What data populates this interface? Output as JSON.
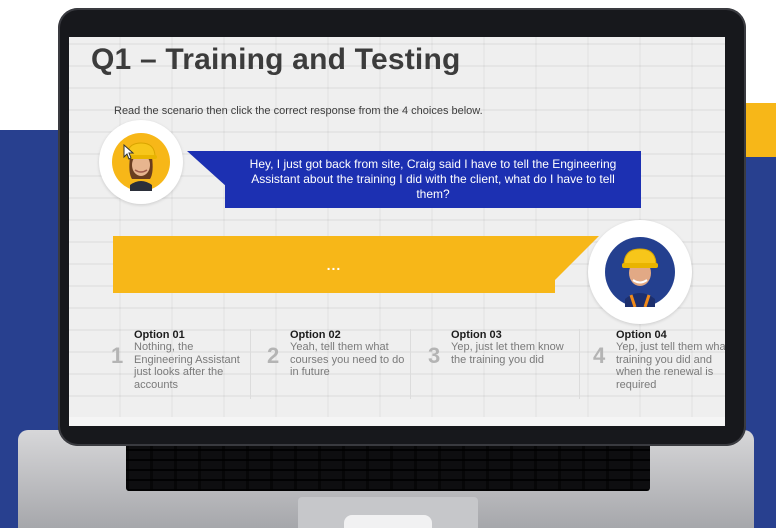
{
  "lesson": {
    "title": "Q1 – Training and Testing",
    "instruction": "Read the scenario then click the correct response from the 4 choices below."
  },
  "dialogue": {
    "speaker_message": "Hey, I just got back from site, Craig said I have to tell the Engineering Assistant about the training I did with the client, what do I have to tell them?",
    "response_placeholder": "..."
  },
  "options": [
    {
      "number": "1",
      "heading": "Option 01",
      "text": "Nothing, the Engineering Assistant just looks after the accounts"
    },
    {
      "number": "2",
      "heading": "Option 02",
      "text": "Yeah, tell them what courses you need to do in future"
    },
    {
      "number": "3",
      "heading": "Option 03",
      "text": "Yep, just let them know the training you did"
    },
    {
      "number": "4",
      "heading": "Option 04",
      "text": "Yep, just tell them what training you did and when the renewal is required"
    }
  ],
  "colors": {
    "navy": "#28408f",
    "yellow": "#f7b718",
    "bubble_blue": "#1c30b2"
  }
}
